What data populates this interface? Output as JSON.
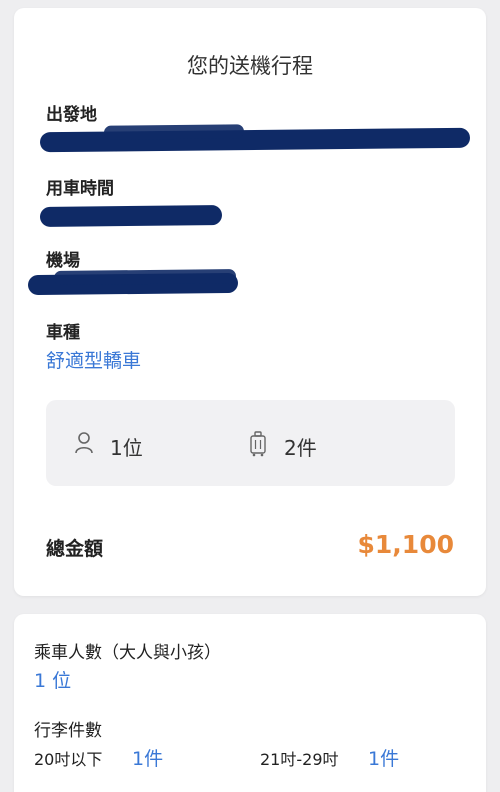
{
  "trip": {
    "title": "您的送機行程",
    "departure_label": "出發地",
    "time_label": "用車時間",
    "airport_label": "機場",
    "car_type_label": "車種",
    "car_type_value": "舒適型轎車",
    "passengers": "1位",
    "luggage": "2件",
    "total_label": "總金額",
    "total_value": "$1,100",
    "accent_color": "#e8893a",
    "link_color": "#3a78d6",
    "redaction_color": "#0f2a66"
  },
  "details": {
    "passenger_label": "乘車人數（大人與小孩）",
    "passenger_value": "1 位",
    "luggage_label": "行李件數",
    "size_small_label": "20吋以下",
    "size_small_count": "1件",
    "size_large_label": "21吋-29吋",
    "size_large_count": "1件"
  },
  "icons": {
    "person": "person-icon",
    "luggage": "luggage-icon"
  }
}
